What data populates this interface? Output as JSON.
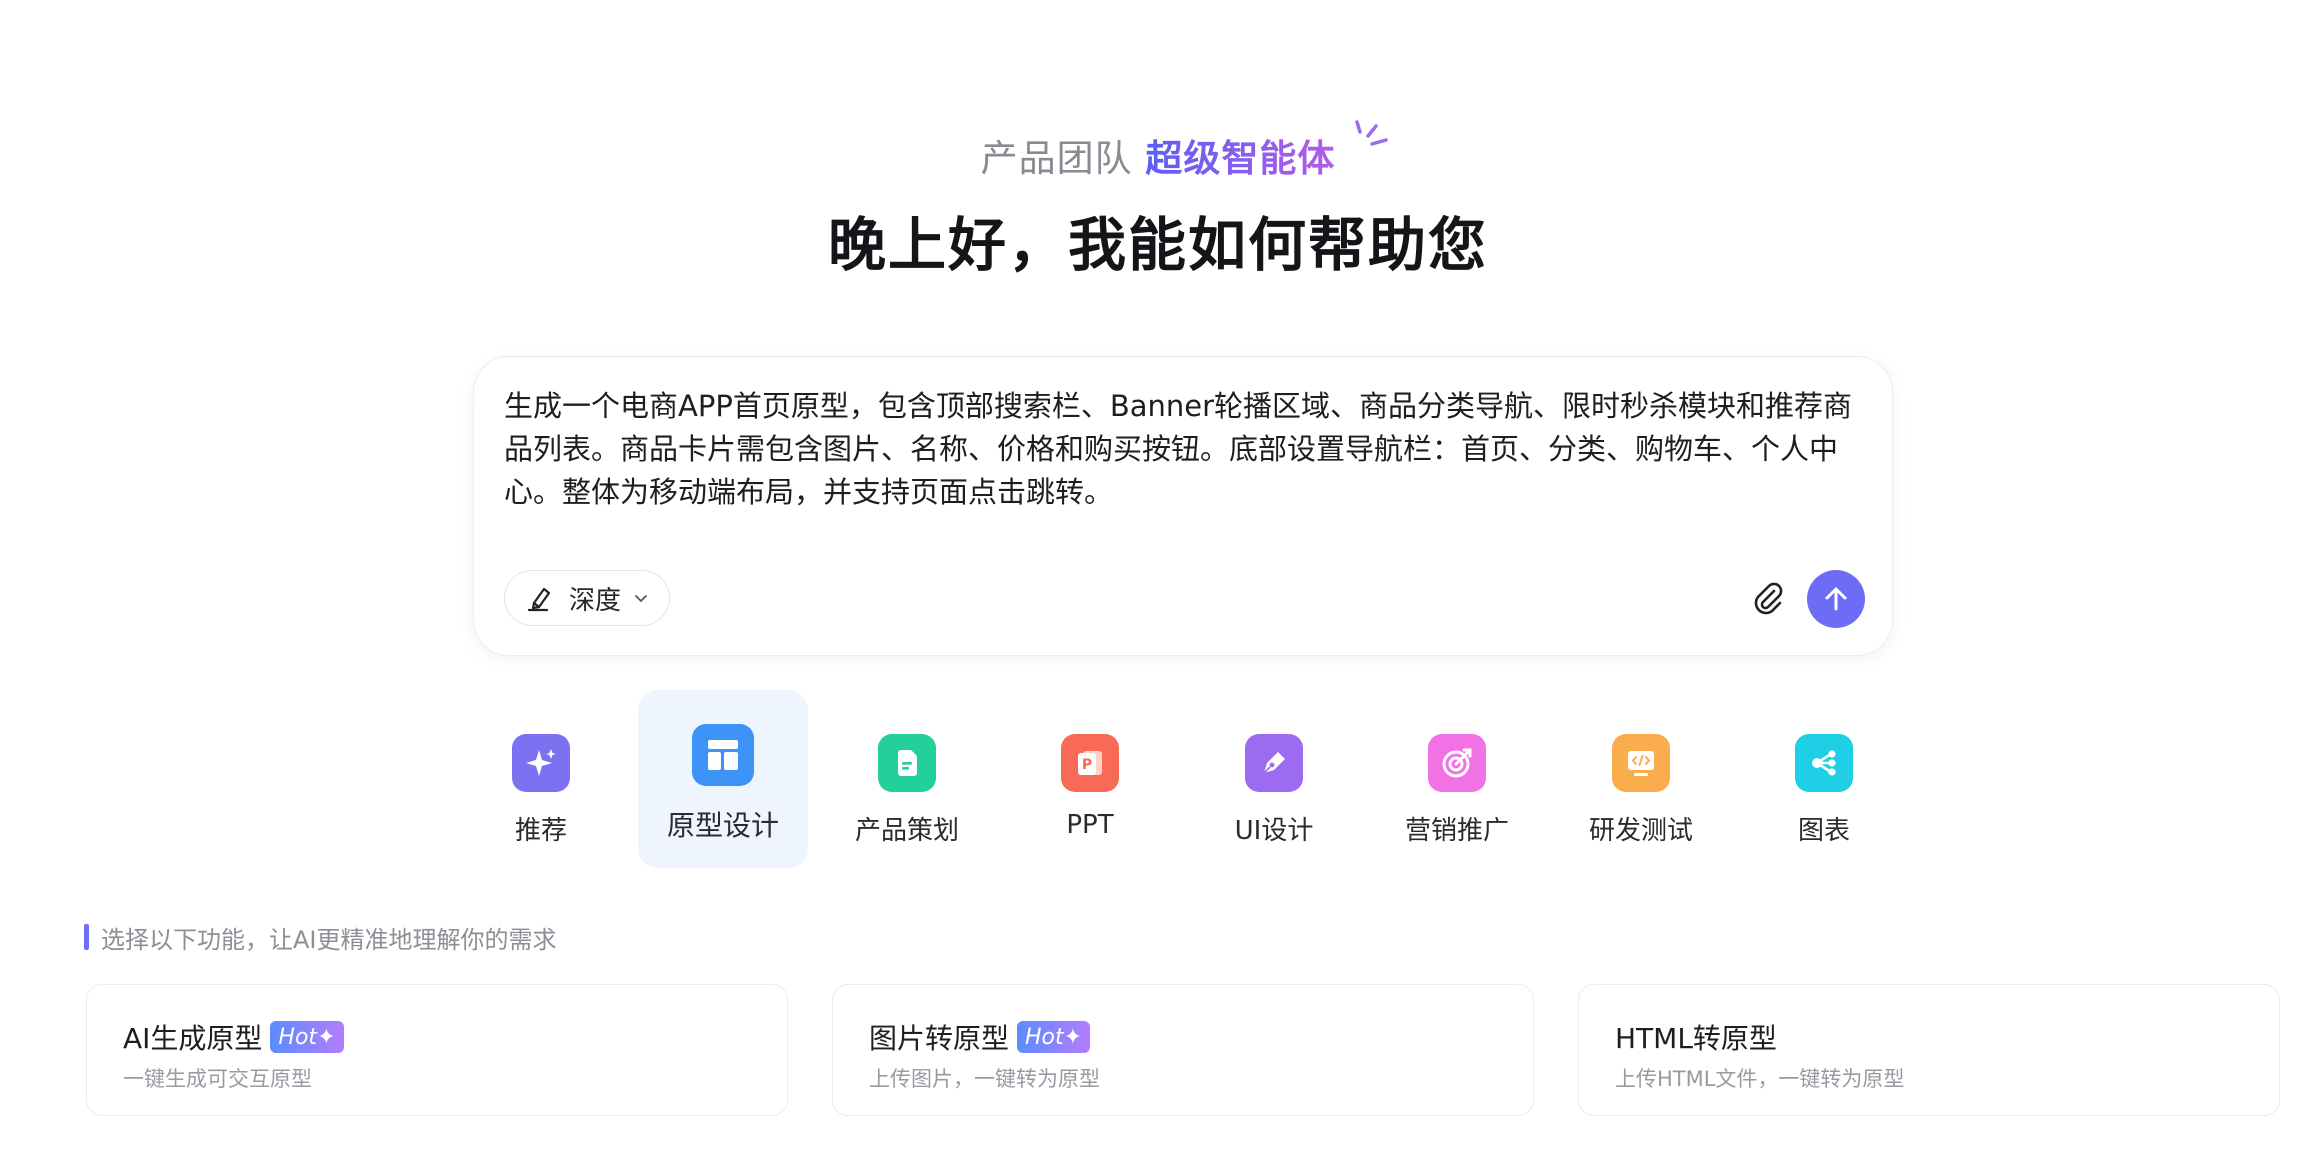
{
  "hero": {
    "team": "产品团队",
    "agent": "超级智能体",
    "title": "晚上好，我能如何帮助您"
  },
  "prompt": {
    "text": "生成一个电商APP首页原型，包含顶部搜索栏、Banner轮播区域、商品分类导航、限时秒杀模块和推荐商品列表。商品卡片需包含图片、名称、价格和购买按钮。底部设置导航栏：首页、分类、购物车、个人中心。整体为移动端布局，并支持页面点击跳转。",
    "mode": "深度"
  },
  "categories": [
    {
      "label": "推荐",
      "icon": "sparkle-icon",
      "color": "#7b72f2"
    },
    {
      "label": "原型设计",
      "icon": "layout-icon",
      "color": "#3e94f6",
      "active": true
    },
    {
      "label": "产品策划",
      "icon": "document-icon",
      "color": "#23cf9a"
    },
    {
      "label": "PPT",
      "icon": "ppt-icon",
      "color": "#f86a55"
    },
    {
      "label": "UI设计",
      "icon": "pen-icon",
      "color": "#9d6bf0"
    },
    {
      "label": "营销推广",
      "icon": "target-icon",
      "color": "#f272e6"
    },
    {
      "label": "研发测试",
      "icon": "code-icon",
      "color": "#f9ad4c"
    },
    {
      "label": "图表",
      "icon": "share-nodes-icon",
      "color": "#1ecfe6"
    }
  ],
  "hint": "选择以下功能，让AI更精准地理解你的需求",
  "features": [
    {
      "title": "AI生成原型",
      "badge": "Hot",
      "desc": "一键生成可交互原型"
    },
    {
      "title": "图片转原型",
      "badge": "Hot",
      "desc": "上传图片，一键转为原型"
    },
    {
      "title": "HTML转原型",
      "desc": "上传HTML文件，一键转为原型"
    }
  ],
  "colors": {
    "accent": "#6c6cf6",
    "active_bg": "#eef5ff"
  }
}
